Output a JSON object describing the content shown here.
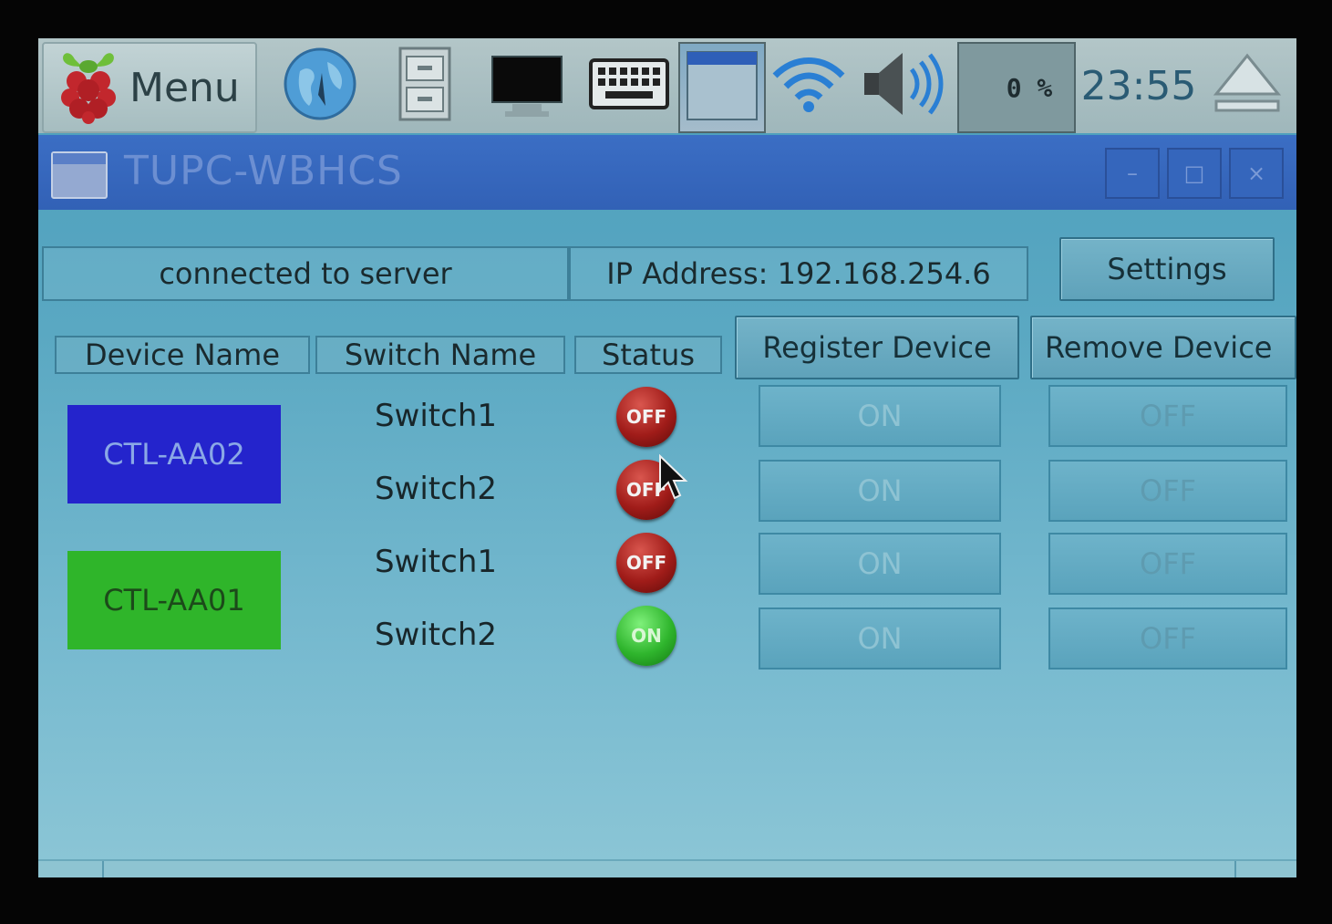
{
  "taskbar": {
    "menu_label": "Menu",
    "cpu_usage": "0 %",
    "clock": "23:55"
  },
  "window": {
    "title": "TUPC-WBHCS",
    "controls": {
      "minimize": "–",
      "maximize": "□",
      "close": "×"
    }
  },
  "main": {
    "connection_status": "connected to server",
    "ip_address": "IP Address: 192.168.254.6",
    "settings_label": "Settings",
    "register_label": "Register Device",
    "remove_label": "Remove Device",
    "columns": {
      "device": "Device Name",
      "switch": "Switch Name",
      "status": "Status"
    },
    "devices": [
      {
        "name": "CTL-AA02",
        "color": "#2424cc",
        "text_color": "#8aa8e6"
      },
      {
        "name": "CTL-AA01",
        "color": "#2fb52a",
        "text_color": "#1c4a1a"
      }
    ],
    "rows": [
      {
        "switch": "Switch1",
        "status": "OFF",
        "on_label": "ON",
        "off_label": "OFF"
      },
      {
        "switch": "Switch2",
        "status": "OFF",
        "on_label": "ON",
        "off_label": "OFF"
      },
      {
        "switch": "Switch1",
        "status": "OFF",
        "on_label": "ON",
        "off_label": "OFF"
      },
      {
        "switch": "Switch2",
        "status": "ON",
        "on_label": "ON",
        "off_label": "OFF"
      }
    ]
  }
}
